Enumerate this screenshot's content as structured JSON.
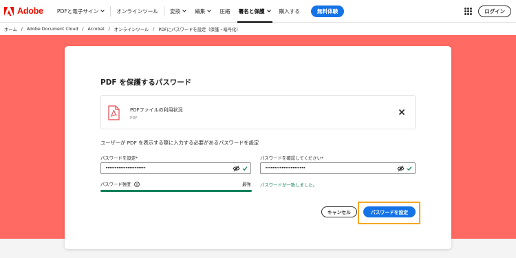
{
  "brand": {
    "name": "Adobe",
    "color": "#eb1000",
    "logo_icon": "adobe-logo-icon"
  },
  "nav": {
    "items": [
      {
        "label": "PDFと電子サイン",
        "dropdown": true
      },
      {
        "label": "オンラインツール",
        "dropdown": false
      },
      {
        "label": "変換",
        "dropdown": true
      },
      {
        "label": "編集",
        "dropdown": true
      },
      {
        "label": "圧縮",
        "dropdown": false
      },
      {
        "label": "署名と保護",
        "dropdown": true,
        "active": true
      },
      {
        "label": "購入する",
        "dropdown": false
      }
    ],
    "trial_button": "無料体験",
    "apps_icon": "app-grid-icon",
    "login_button": "ログイン"
  },
  "breadcrumb": [
    "ホーム",
    "Adobe Document Cloud",
    "Acrobat",
    "オンラインツール",
    "PDFにパスワードを設定（保護・暗号化）"
  ],
  "breadcrumb_separator": "/",
  "dialog": {
    "title": "PDF を保護するパスワード",
    "file": {
      "name": "PDFファイルの利用状況",
      "type": "PDF",
      "icon": "pdf-file-icon",
      "remove_icon": "close-icon"
    },
    "instruction": "ユーザーが PDF を表示する際に入力する必要があるパスワードを設定",
    "password_field": {
      "label": "パスワードを設定*",
      "masked_value": "••••••••••••••••••••••",
      "toggle_icon": "eye-slash-icon",
      "valid_icon": "check-icon"
    },
    "confirm_field": {
      "label": "パスワードを確認してください*",
      "masked_value": "••••••••••••••••••••••",
      "toggle_icon": "eye-slash-icon",
      "valid_icon": "check-icon"
    },
    "strength": {
      "label": "パスワード強度",
      "info_icon": "info-icon",
      "value_label": "最強",
      "level": 1.0
    },
    "match_message": "パスワードが一致しました。",
    "cancel_button": "キャンセル",
    "submit_button": "パスワードを設定"
  },
  "colors": {
    "accent": "#1473e6",
    "hero_background": "#ff6a63",
    "success": "#12805c",
    "highlight": "#f5a623"
  }
}
